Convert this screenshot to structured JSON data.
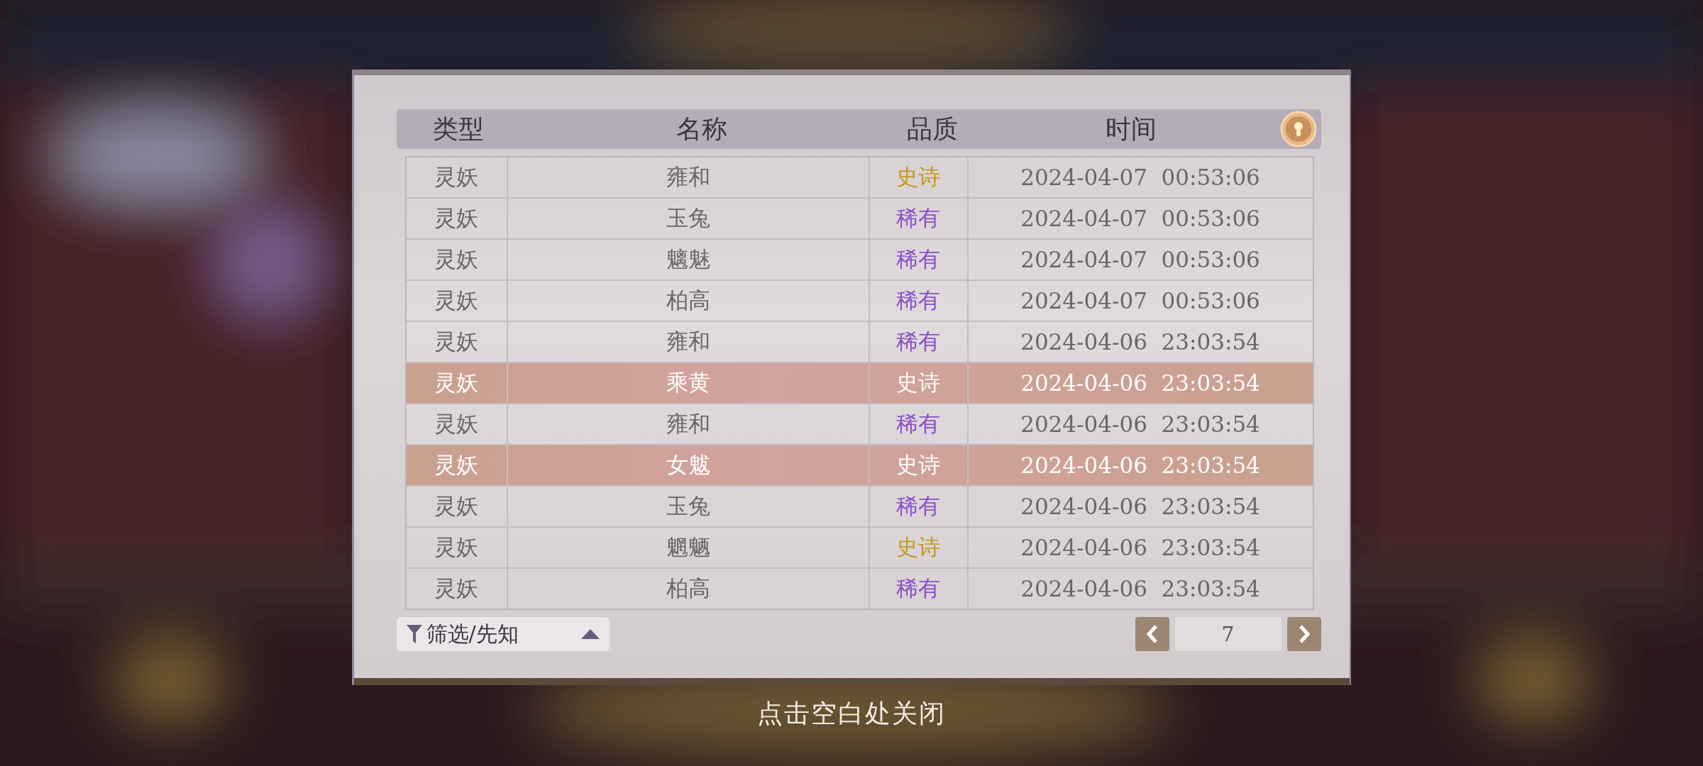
{
  "table": {
    "columns": [
      "类型",
      "名称",
      "品质",
      "时间"
    ],
    "rows": [
      {
        "type": "灵妖",
        "name": "雍和",
        "quality": "史诗",
        "kind": "epic",
        "time": "2024-04-07  00:53:06",
        "highlighted": false
      },
      {
        "type": "灵妖",
        "name": "玉兔",
        "quality": "稀有",
        "kind": "rare",
        "time": "2024-04-07  00:53:06",
        "highlighted": false
      },
      {
        "type": "灵妖",
        "name": "魑魅",
        "quality": "稀有",
        "kind": "rare",
        "time": "2024-04-07  00:53:06",
        "highlighted": false
      },
      {
        "type": "灵妖",
        "name": "柏高",
        "quality": "稀有",
        "kind": "rare",
        "time": "2024-04-07  00:53:06",
        "highlighted": false
      },
      {
        "type": "灵妖",
        "name": "雍和",
        "quality": "稀有",
        "kind": "rare",
        "time": "2024-04-06  23:03:54",
        "highlighted": false
      },
      {
        "type": "灵妖",
        "name": "乘黄",
        "quality": "史诗",
        "kind": "epic",
        "time": "2024-04-06  23:03:54",
        "highlighted": true
      },
      {
        "type": "灵妖",
        "name": "雍和",
        "quality": "稀有",
        "kind": "rare",
        "time": "2024-04-06  23:03:54",
        "highlighted": false
      },
      {
        "type": "灵妖",
        "name": "女魃",
        "quality": "史诗",
        "kind": "epic",
        "time": "2024-04-06  23:03:54",
        "highlighted": true
      },
      {
        "type": "灵妖",
        "name": "玉兔",
        "quality": "稀有",
        "kind": "rare",
        "time": "2024-04-06  23:03:54",
        "highlighted": false
      },
      {
        "type": "灵妖",
        "name": "魍魉",
        "quality": "史诗",
        "kind": "epic",
        "time": "2024-04-06  23:03:54",
        "highlighted": false
      },
      {
        "type": "灵妖",
        "name": "柏高",
        "quality": "稀有",
        "kind": "rare",
        "time": "2024-04-06  23:03:54",
        "highlighted": false
      }
    ]
  },
  "filter": {
    "label": "筛选/先知"
  },
  "pager": {
    "page": "7"
  },
  "close_hint": "点击空白处关闭"
}
